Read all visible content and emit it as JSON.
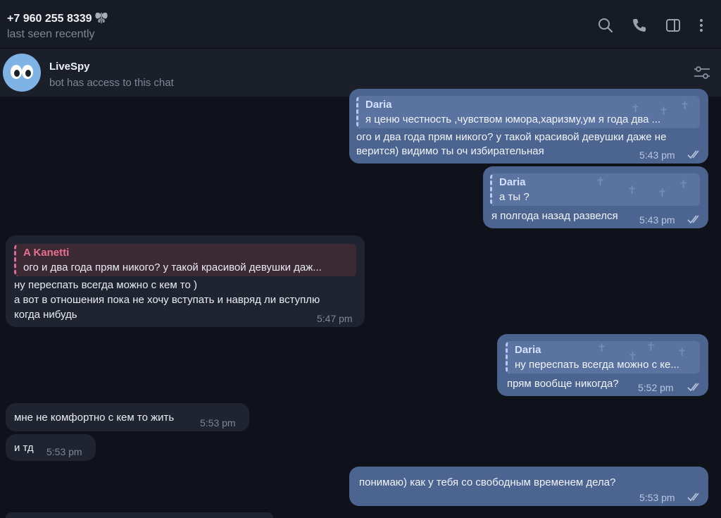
{
  "header": {
    "contact_name": "+7 960 255 8339",
    "status": "last seen recently",
    "icons": [
      "search-icon",
      "phone-icon",
      "sidebar-toggle-icon",
      "more-icon"
    ]
  },
  "bot_bar": {
    "name": "LiveSpy",
    "subtitle": "bot has access to this chat",
    "icon": "settings-sliders-icon"
  },
  "messages": [
    {
      "dir": "out",
      "reply_name": "Daria",
      "reply_text": "я ценю честность ,чувством юмора,харизму,ум  я года два ...",
      "lines": [
        "ого и два года прям никого? у такой красивой девушки даже не",
        "верится) видимо ты оч избирательная"
      ],
      "time": "5:43 pm"
    },
    {
      "dir": "out",
      "reply_name": "Daria",
      "reply_text": "а ты ?",
      "lines": [
        "я полгода назад развелся"
      ],
      "time": "5:43 pm"
    },
    {
      "dir": "in",
      "reply_name": "A Kanetti",
      "reply_text": "ого и два года прям никого? у такой красивой девушки даж...",
      "lines": [
        "ну переспать всегда можно с кем то )",
        "а вот в отношения пока не хочу вступать и навряд ли вступлю",
        "когда нибудь"
      ],
      "time": "5:47 pm"
    },
    {
      "dir": "out",
      "reply_name": "Daria",
      "reply_text": "ну переспать всегда можно с ке...",
      "lines": [
        "прям вообще никогда?"
      ],
      "time": "5:52 pm"
    },
    {
      "dir": "in",
      "lines": [
        "мне не комфортно с кем то жить"
      ],
      "time": "5:53 pm"
    },
    {
      "dir": "in",
      "lines": [
        "и тд"
      ],
      "time": "5:53 pm"
    },
    {
      "dir": "out",
      "lines": [
        "понимаю) как у тебя со свободным временем дела?"
      ],
      "time": "5:53 pm"
    }
  ],
  "colors": {
    "background": "#0f121a",
    "outgoing_bubble": "#4c6490",
    "incoming_bubble": "#1f2430",
    "reply_incoming_accent": "#e86f92"
  }
}
